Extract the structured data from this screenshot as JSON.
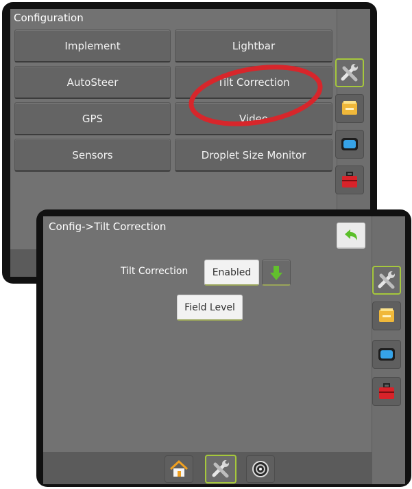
{
  "back_panel": {
    "title": "Configuration",
    "buttons": [
      "Implement",
      "Lightbar",
      "AutoSteer",
      "Tilt Correction",
      "GPS",
      "Video",
      "Sensors",
      "Droplet Size Monitor"
    ]
  },
  "front_panel": {
    "title": "Config->Tilt Correction",
    "tilt_label": "Tilt Correction",
    "tilt_value": "Enabled",
    "field_level_label": "Field Level"
  },
  "side_icons": [
    "tools-icon",
    "gallery-icon",
    "display-icon",
    "toolbox-icon"
  ],
  "bottom_nav": [
    "home-icon",
    "tools-icon",
    "gauge-icon"
  ],
  "colors": {
    "accent": "#a6c83c",
    "highlight_ellipse": "#d7262b",
    "screen": "#727272"
  }
}
